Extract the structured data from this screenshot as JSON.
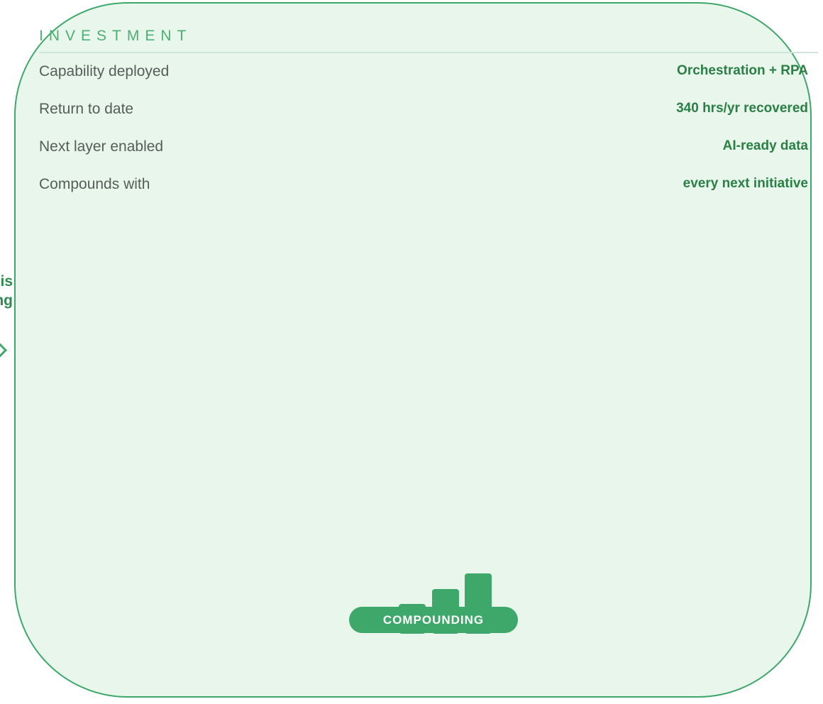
{
  "left_fragment": {
    "line1": "his",
    "line2": "ng"
  },
  "card": {
    "section_label": "INVESTMENT",
    "rows": [
      {
        "label": "Capability deployed",
        "value": "Orchestration + RPA"
      },
      {
        "label": "Return to date",
        "value": "340 hrs/yr recovered"
      },
      {
        "label": "Next layer enabled",
        "value": "AI-ready data"
      },
      {
        "label": "Compounds with",
        "value": "every next initiative"
      }
    ],
    "badge": "COMPOUNDING",
    "icon": "growth-bars-icon"
  },
  "colors": {
    "accent": "#3ea86a",
    "card_background": "#e8f6ec",
    "value_text": "#2a7f45",
    "label_text": "#555e58"
  }
}
